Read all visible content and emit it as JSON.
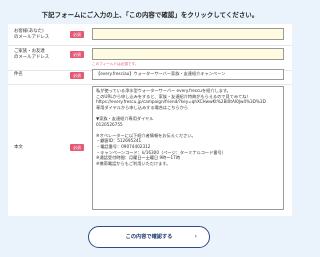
{
  "instruction": "下記フォームにご入力の上、「この内容で確認」をクリックしてください。",
  "required_badge": "必須",
  "fields": {
    "email": {
      "label_line1": "お客様(あなた)",
      "label_line2": "のメールアドレス",
      "value": ""
    },
    "email_confirm": {
      "label_line1": "ご家族・お友達",
      "label_line2": "のメールアドレス",
      "value": "",
      "error": "このフィールドは必須です。"
    },
    "subject": {
      "label": "件名",
      "value": "【every.fresciau】ウォーターサーバー家族・友達紹介キャンペーン"
    },
    "body": {
      "label": "本文",
      "value": "私が使っている浄水型ウォーターサーバー every.frescuを紹介します。\nこのURLから申し込みをすると、家族・友達紹介特典がもらえるので見てみてね！\nhttps://every.frescu.jp/campaign/friend/?key=qhXCHwwKt%2BI0tAI0Jw4%3D%3D\n専用ダイヤルから申し込みする場合はこちらから\n\n▼家族・友達紹介専用ダイヤル\n0120526755\n\n※オペレーターに以下紹介者情報をお伝えください。\n・顧客ID：512695241\n・電話番号：09074402312\n・キャンペーンコード：k/16300（ページ：ターミナルコード番号）\n※通話受付時間：月曜日～土曜日 9時～17時\n※携帯電話からもご利用いただけます。"
    }
  },
  "confirm_button": {
    "label": "この内容で確認する",
    "chevron": "›"
  }
}
